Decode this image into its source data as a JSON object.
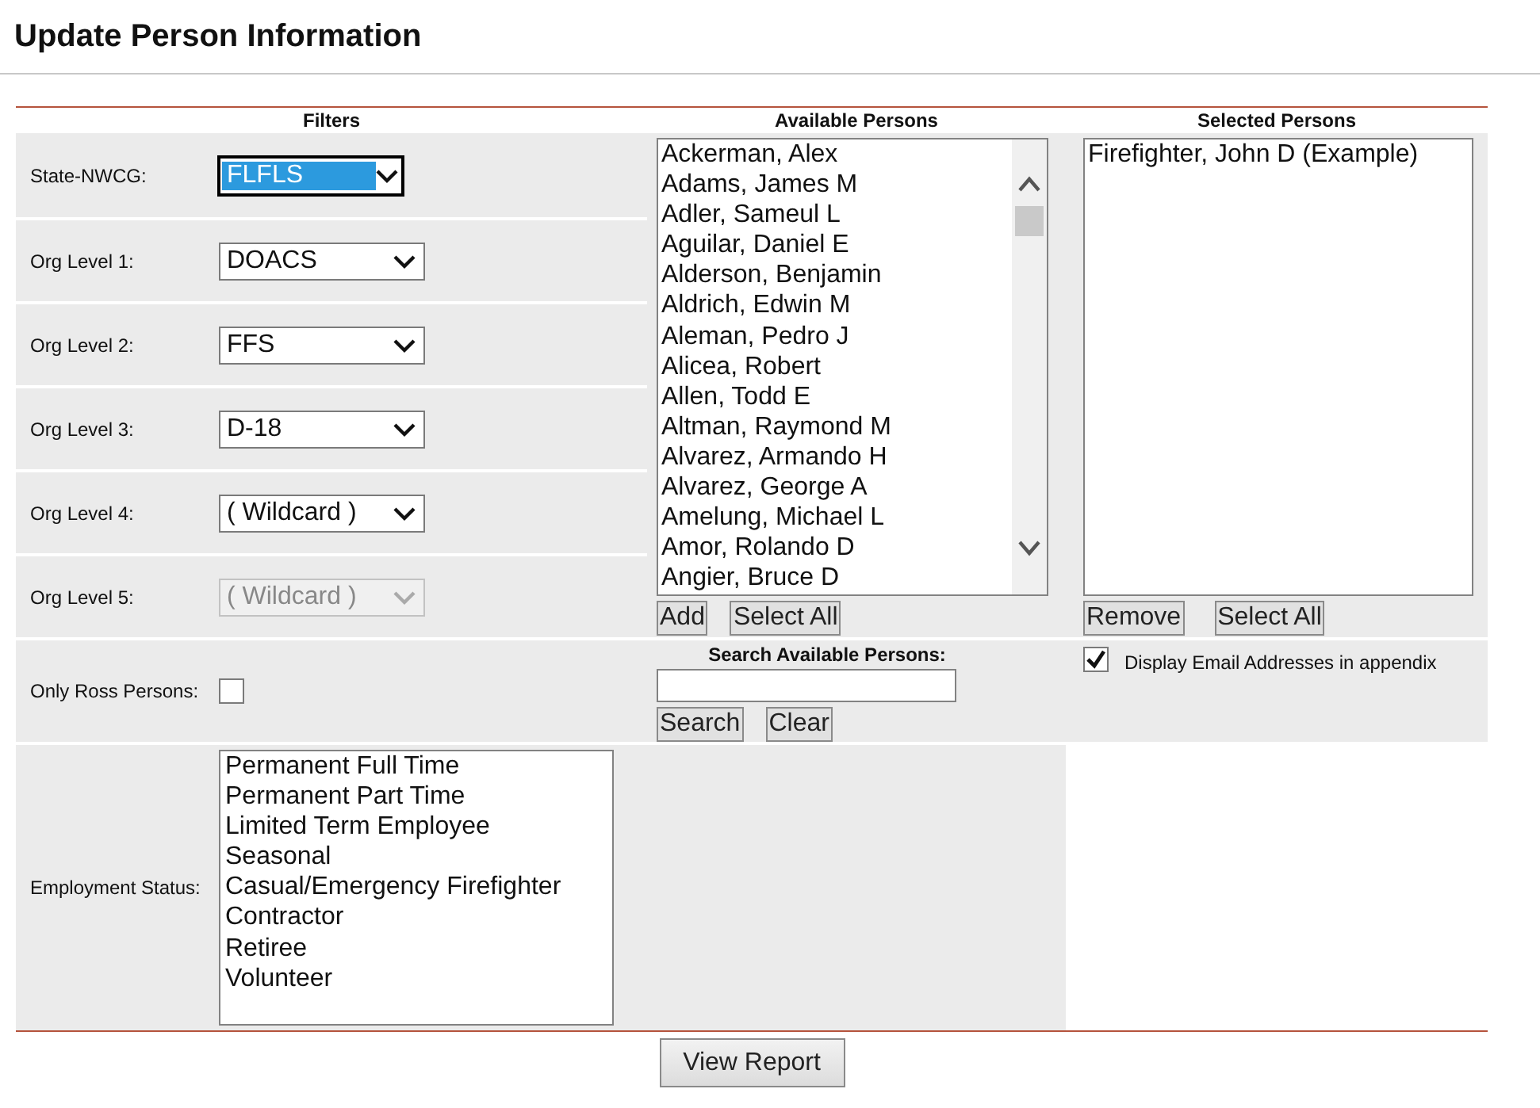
{
  "title": "Update Person Information",
  "headers": {
    "filters": "Filters",
    "available": "Available Persons",
    "selected": "Selected Persons"
  },
  "filters": [
    {
      "label": "State-NWCG:",
      "value": "FLFLS",
      "focused": true,
      "disabled": false
    },
    {
      "label": "Org Level 1:",
      "value": "DOACS",
      "focused": false,
      "disabled": false
    },
    {
      "label": "Org Level 2:",
      "value": "FFS",
      "focused": false,
      "disabled": false
    },
    {
      "label": "Org Level 3:",
      "value": "D-18",
      "focused": false,
      "disabled": false
    },
    {
      "label": "Org Level 4:",
      "value": "( Wildcard )",
      "focused": false,
      "disabled": false
    },
    {
      "label": "Org Level 5:",
      "value": "( Wildcard )",
      "focused": false,
      "disabled": true
    }
  ],
  "available_persons": [
    "Ackerman, Alex",
    "Adams, James M",
    "Adler, Sameul L",
    "Aguilar, Daniel E",
    "Alderson, Benjamin",
    "Aldrich, Edwin M",
    "Aleman, Pedro J",
    "Alicea, Robert",
    "Allen, Todd E",
    "Altman, Raymond M",
    "Alvarez, Armando H",
    "Alvarez, George A",
    "Amelung, Michael L",
    "Amor, Rolando D",
    "Angier, Bruce D"
  ],
  "available_buttons": [
    "Add",
    "Select All"
  ],
  "selected_persons": [
    "Firefighter, John D (Example)"
  ],
  "selected_buttons": [
    "Remove",
    "Select All"
  ],
  "only_ross": {
    "label": "Only Ross Persons:",
    "checked": false
  },
  "search": {
    "label": "Search Available Persons:",
    "buttons": [
      "Search",
      "Clear"
    ]
  },
  "email_option": {
    "label": "Display Email Addresses in appendix",
    "checked": true
  },
  "employment": {
    "label": "Employment Status:",
    "options": [
      "Permanent Full Time",
      "Permanent Part Time",
      "Limited Term Employee",
      "Seasonal",
      "Casual/Emergency Firefighter",
      "Contractor",
      "Retiree",
      "Volunteer"
    ]
  },
  "view_report": "View Report"
}
